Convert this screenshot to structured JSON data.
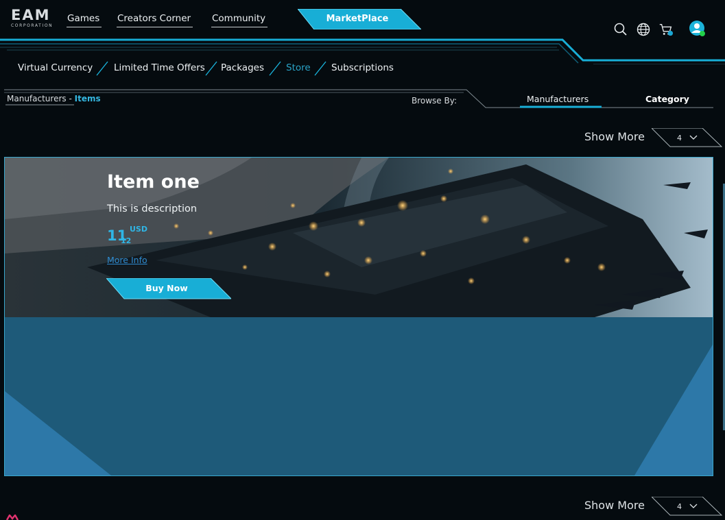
{
  "header": {
    "logo_main": "EAM",
    "logo_sub": "CORPORATION",
    "nav": [
      "Games",
      "Creators Corner",
      "Community"
    ],
    "marketplace_label": "MarketPlace",
    "icons": [
      "search-icon",
      "globe-icon",
      "cart-icon",
      "user-avatar-icon"
    ]
  },
  "subnav": {
    "items": [
      "Virtual Currency",
      "Limited Time Offers",
      "Packages",
      "Store",
      "Subscriptions"
    ],
    "active": "Store"
  },
  "browse": {
    "breadcrumb_root": "Manufacturers",
    "breadcrumb_sep": " - ",
    "breadcrumb_current": "Items",
    "label": "Browse By:",
    "tabs": [
      "Manufacturers",
      "Category"
    ],
    "active_tab": "Manufacturers"
  },
  "pager": {
    "show_more_label": "Show More",
    "value": "4"
  },
  "item": {
    "title": "Item one",
    "description": "This is description",
    "price_int": "11",
    "price_dec": "12",
    "currency": "USD",
    "more_info": "More Info",
    "buy_label": "Buy Now"
  },
  "colors": {
    "background": "#050b0f",
    "accent": "#19b0d8",
    "card": "#1e5a79",
    "price": "#2fb6e6"
  }
}
